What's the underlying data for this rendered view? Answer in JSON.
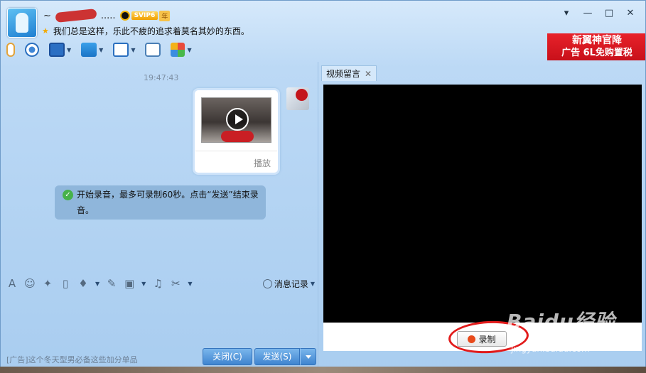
{
  "header": {
    "name_prefix": "~",
    "name_suffix": ".....",
    "vip_label": "SVIP6",
    "year_label": "年",
    "signature": "我们总是这样，乐此不疲的追求着莫名其妙的东西。"
  },
  "window_controls": {
    "dropdown": "▾",
    "minimize": "—",
    "maximize": "□",
    "close": "✕"
  },
  "ad_banner": {
    "line1": "新翼神官降",
    "line2": "广告 6L免购置税"
  },
  "chat": {
    "timestamp": "19:47:43",
    "video_action": "播放",
    "notice": "开始录音，最多可录制60秒。点击“发送”结束录音。"
  },
  "input_toolbar": {
    "history_label": "消息记录"
  },
  "footer": {
    "ad_text": "[广告]这个冬天型男必备这些加分单品",
    "close_label": "关闭(C)",
    "send_label": "发送(S)"
  },
  "right_pane": {
    "tab_label": "视频留言",
    "tab_close": "✕",
    "record_label": "录制"
  },
  "watermark": {
    "logo": "Baidu经验",
    "url": "jingyan.baidu.com"
  },
  "colors": {
    "accent_blue": "#3f84cf",
    "record_red": "#e84a1b",
    "highlight_red": "#e21b1b"
  }
}
